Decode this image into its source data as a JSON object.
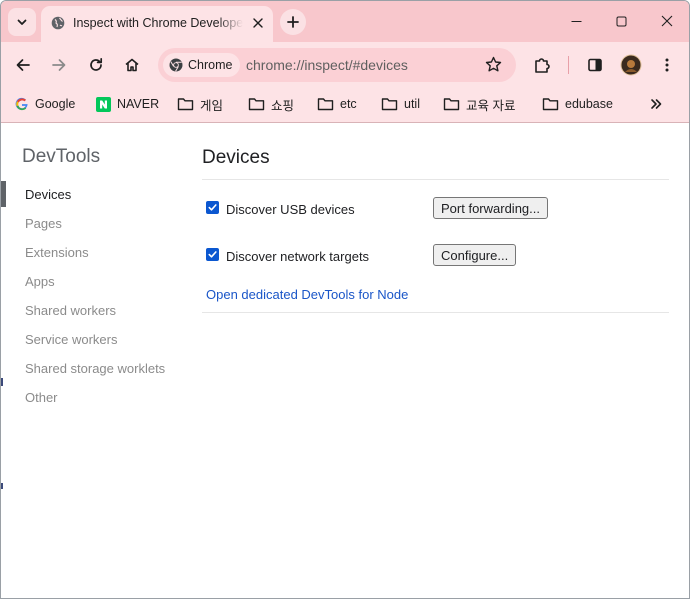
{
  "tab": {
    "title": "Inspect with Chrome Developer Tools"
  },
  "omnibox": {
    "chip_label": "Chrome",
    "url": "chrome://inspect/#devices"
  },
  "bookmarks": [
    {
      "label": "Google",
      "icon": "google-icon"
    },
    {
      "label": "NAVER",
      "icon": "naver-icon"
    },
    {
      "label": "게임",
      "icon": "folder-icon"
    },
    {
      "label": "쇼핑",
      "icon": "folder-icon"
    },
    {
      "label": "etc",
      "icon": "folder-icon"
    },
    {
      "label": "util",
      "icon": "folder-icon"
    },
    {
      "label": "교육 자료",
      "icon": "folder-icon"
    },
    {
      "label": "edubase",
      "icon": "folder-icon"
    }
  ],
  "sidebar": {
    "title": "DevTools",
    "items": [
      {
        "label": "Devices",
        "active": true
      },
      {
        "label": "Pages"
      },
      {
        "label": "Extensions"
      },
      {
        "label": "Apps"
      },
      {
        "label": "Shared workers"
      },
      {
        "label": "Service workers"
      },
      {
        "label": "Shared storage worklets"
      },
      {
        "label": "Other"
      }
    ]
  },
  "main": {
    "title": "Devices",
    "usb": {
      "label": "Discover USB devices",
      "checked": true,
      "button": "Port forwarding..."
    },
    "network": {
      "label": "Discover network targets",
      "checked": true,
      "button": "Configure..."
    },
    "node_link": "Open dedicated DevTools for Node"
  },
  "colors": {
    "titlebar": "#f8c7cc",
    "toolbar": "#fde3e6",
    "checkbox": "#0b57d0",
    "link": "#1a56c8"
  }
}
